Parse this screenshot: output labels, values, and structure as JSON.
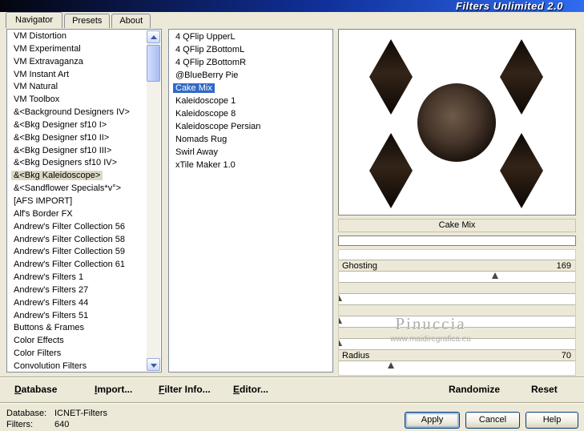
{
  "window": {
    "title": "Filters Unlimited 2.0"
  },
  "tabs": {
    "navigator": "Navigator",
    "presets": "Presets",
    "about": "About"
  },
  "categories": {
    "selected_index": 11,
    "items": [
      "VM Distortion",
      "VM Experimental",
      "VM Extravaganza",
      "VM Instant Art",
      "VM Natural",
      "VM Toolbox",
      "&<Background Designers IV>",
      "&<Bkg Designer sf10 I>",
      "&<Bkg Designer sf10 II>",
      "&<Bkg Designer sf10 III>",
      "&<Bkg Designers sf10 IV>",
      "&<Bkg Kaleidoscope>",
      "&<Sandflower Specials*v°>",
      "[AFS IMPORT]",
      "Alf's Border FX",
      "Andrew's Filter Collection 56",
      "Andrew's Filter Collection 58",
      "Andrew's Filter Collection 59",
      "Andrew's Filter Collection 61",
      "Andrew's Filters 1",
      "Andrew's Filters 27",
      "Andrew's Filters 44",
      "Andrew's Filters 51",
      "Buttons & Frames",
      "Color Effects",
      "Color Filters",
      "Convolution Filters"
    ]
  },
  "filters": {
    "selected_index": 4,
    "items": [
      "4 QFlip UpperL",
      "4 QFlip ZBottomL",
      "4 QFlip ZBottomR",
      "@BlueBerry Pie",
      "Cake Mix",
      "Kaleidoscope 1",
      "Kaleidoscope 8",
      "Kaleidoscope Persian",
      "Nomads Rug",
      "Swirl Away",
      "xTile Maker 1.0"
    ]
  },
  "preview": {
    "filter_name": "Cake Mix"
  },
  "params": {
    "items": [
      {
        "label": "Ghosting",
        "value": "169",
        "pos": 66
      },
      {
        "label": "",
        "value": "",
        "pos": 0
      },
      {
        "label": "",
        "value": "",
        "pos": 0
      },
      {
        "label": "",
        "value": "",
        "pos": 0
      },
      {
        "label": "Radius",
        "value": "70",
        "pos": 22
      }
    ]
  },
  "watermark": {
    "name": "Pinuccia",
    "url": "www.maidiregrafica.eu"
  },
  "command_bar": {
    "items": [
      {
        "head": "D",
        "tail": "atabase"
      },
      {
        "head": "I",
        "tail": "mport..."
      },
      {
        "head": "F",
        "tail": "ilter Info..."
      },
      {
        "head": "E",
        "tail": "ditor..."
      },
      {
        "head": "",
        "tail": "Randomize"
      },
      {
        "head": "",
        "tail": "Reset"
      }
    ]
  },
  "status": {
    "database_label": "Database:",
    "database_value": "ICNET-Filters",
    "filters_label": "Filters:",
    "filters_value": "640"
  },
  "buttons": {
    "apply": "Apply",
    "cancel": "Cancel",
    "help": "Help"
  },
  "colors": {
    "dialog-bg": "#ECE9D8",
    "selection-blue": "#316AC5",
    "inactive-selection": "#DCD8C4",
    "title-grad-left": "#05050f",
    "title-grad-mid": "#10309a",
    "title-grad-right": "#2f6cf0",
    "watermark-gray": "#ACACAC",
    "preview-diamond": "#332418",
    "preview-circle": "#6e5a48"
  }
}
